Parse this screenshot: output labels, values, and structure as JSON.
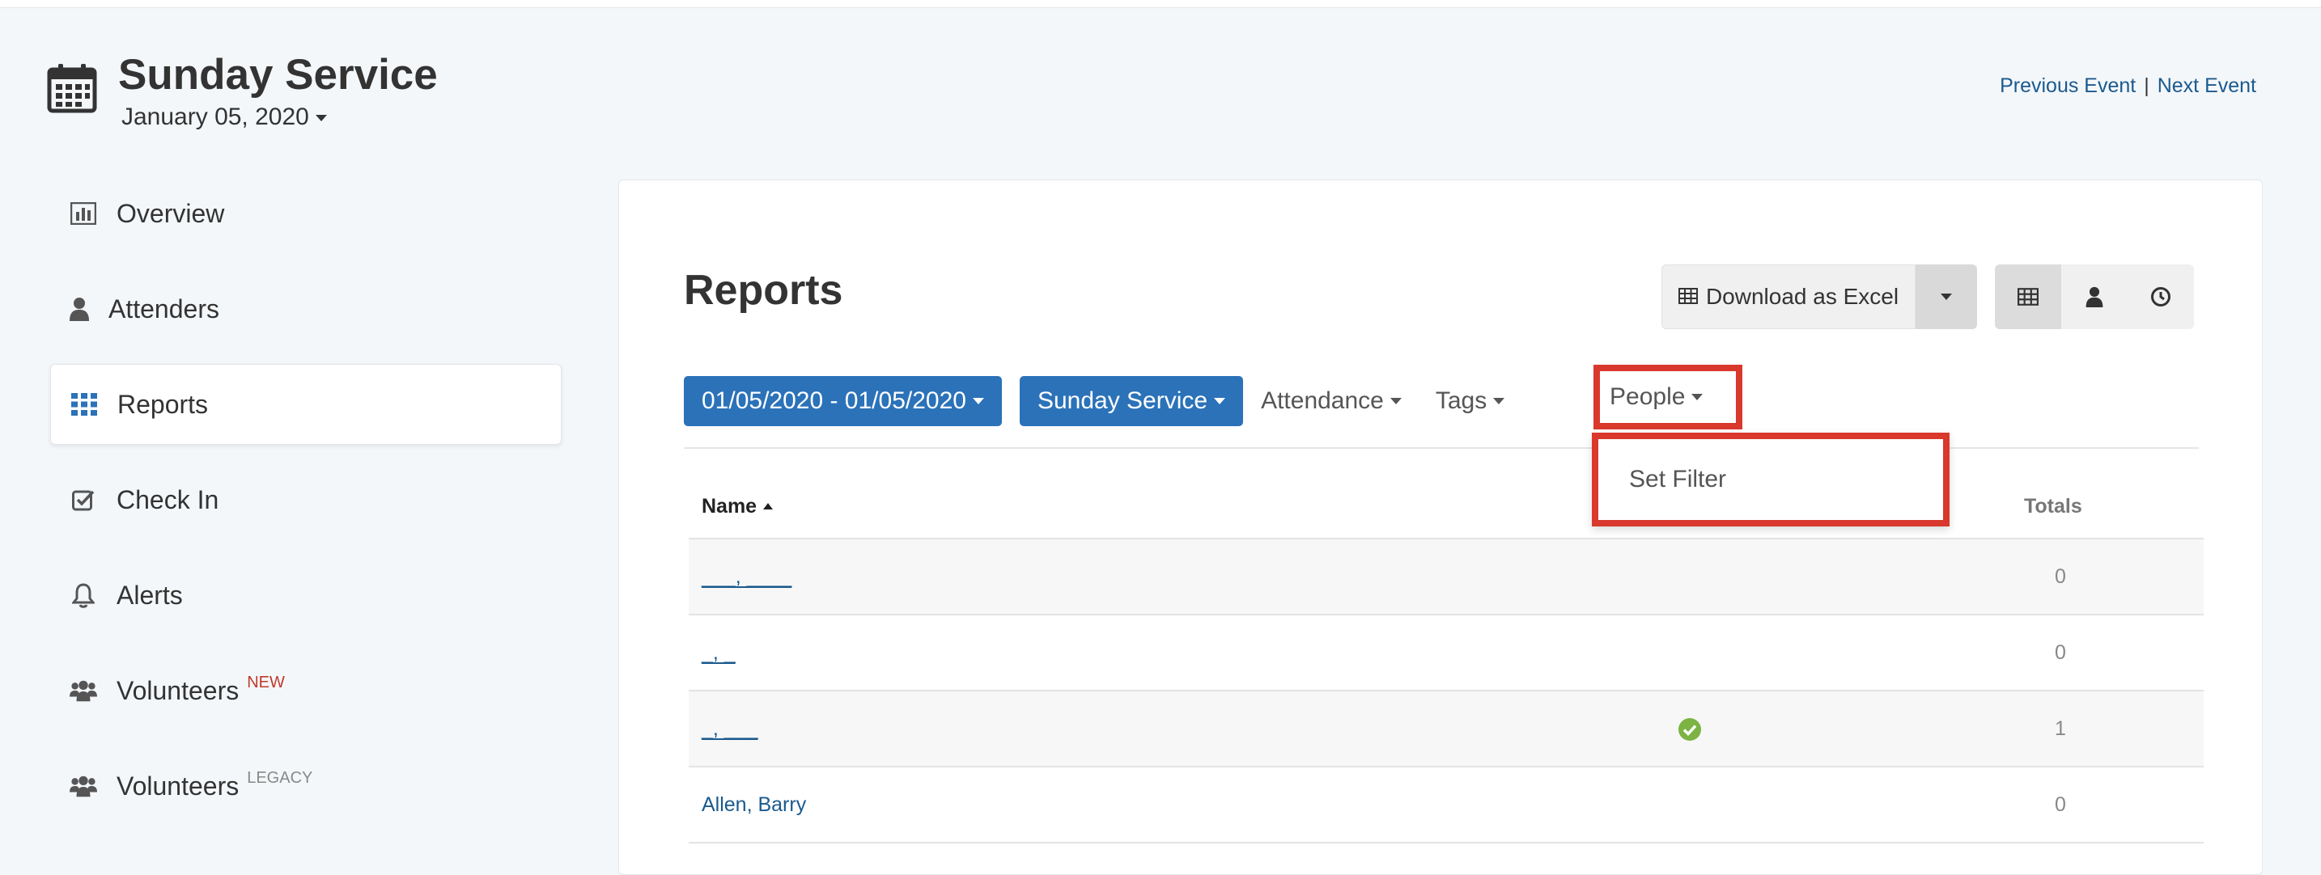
{
  "event": {
    "title": "Sunday Service",
    "date": "January 05, 2020",
    "previous_label": "Previous Event",
    "separator": "|",
    "next_label": "Next Event"
  },
  "sidebar": {
    "items": [
      {
        "label": "Overview",
        "icon": "bar-chart-icon"
      },
      {
        "label": "Attenders",
        "icon": "user-icon"
      },
      {
        "label": "Reports",
        "icon": "grid-icon",
        "active": true
      },
      {
        "label": "Check In",
        "icon": "checkbox-icon"
      },
      {
        "label": "Alerts",
        "icon": "bell-icon"
      },
      {
        "label": "Volunteers",
        "icon": "users-icon",
        "badge": "NEW"
      },
      {
        "label": "Volunteers",
        "icon": "users-icon",
        "badge": "LEGACY"
      }
    ]
  },
  "reports": {
    "title": "Reports",
    "download_label": "Download as Excel",
    "view_icons": [
      "table-view-icon",
      "person-view-icon",
      "clock-view-icon"
    ]
  },
  "filters": {
    "date_range": "01/05/2020 - 01/05/2020",
    "event": "Sunday Service",
    "attendance": "Attendance",
    "tags": "Tags",
    "people": "People"
  },
  "dropdown": {
    "set_filter": "Set Filter"
  },
  "table": {
    "headers": {
      "name": "Name",
      "totals": "Totals"
    },
    "rows": [
      {
        "name": "___, ____",
        "checked": false,
        "total": "0"
      },
      {
        "name": "_, _",
        "checked": false,
        "total": "0"
      },
      {
        "name": "_, ___",
        "checked": true,
        "total": "1"
      },
      {
        "name": "Allen, Barry",
        "checked": false,
        "total": "0"
      }
    ]
  },
  "colors": {
    "primary": "#2b72b9",
    "link": "#1a5a8e",
    "highlight": "#d9382c",
    "check": "#7cb342",
    "new_badge": "#c0392b"
  }
}
